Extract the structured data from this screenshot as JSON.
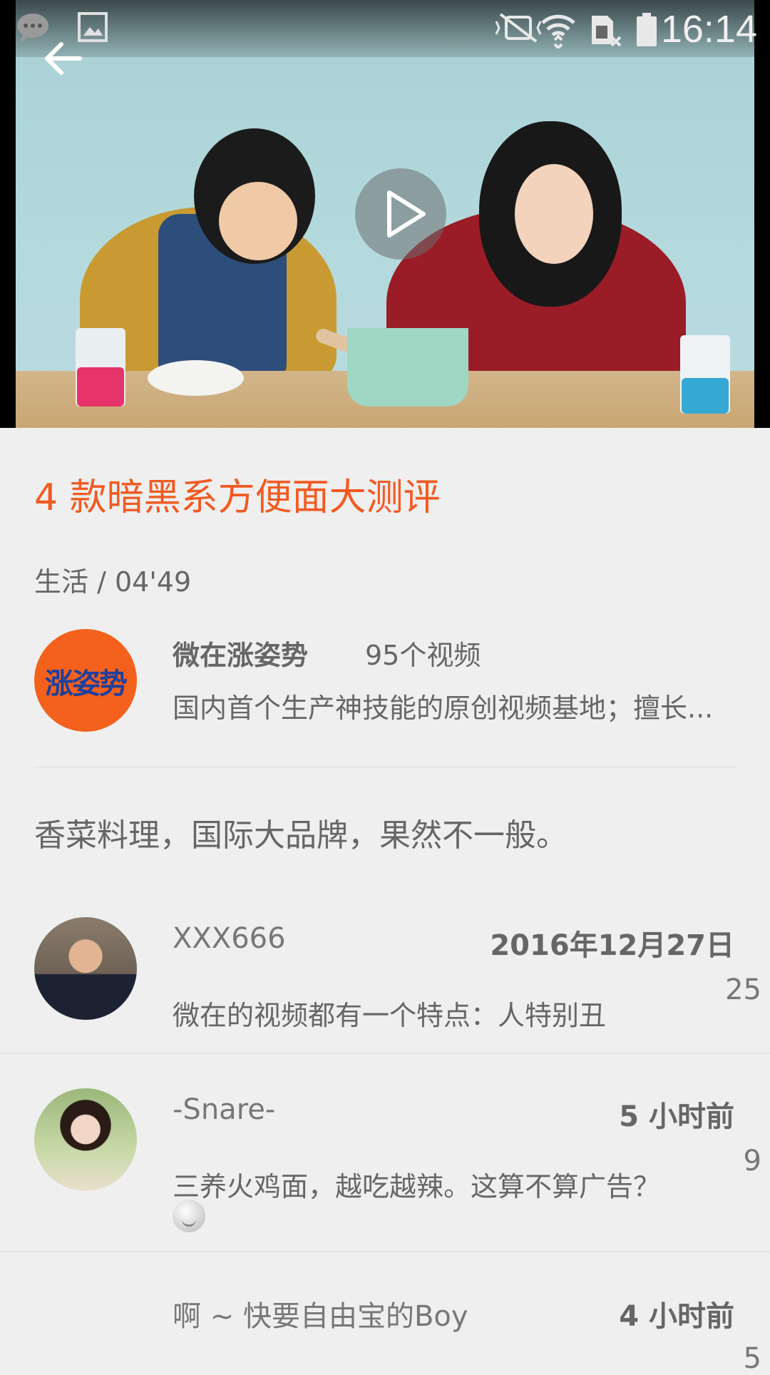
{
  "status_bar": {
    "time": "16:14",
    "icons": [
      "message-icon",
      "image-icon",
      "mute-icon",
      "wifi-icon",
      "no-sim-icon",
      "battery-icon"
    ]
  },
  "video": {
    "play_icon": "play-icon",
    "back_icon": "arrow-left-icon"
  },
  "title": "4 款暗黑系方便面大测评",
  "meta": "生活 / 04'49",
  "channel": {
    "logo_text": "涨姿势",
    "name": "微在涨姿势",
    "video_count": "95个视频",
    "description": "国内首个生产神技能的原创视频基地；擅长..."
  },
  "summary": "香菜料理，国际大品牌，果然不一般。",
  "comments": [
    {
      "user": "XXX666",
      "date": "2016年12月27日",
      "text": "微在的视频都有一个特点：人特别丑",
      "likes": "25"
    },
    {
      "user": "-Snare-",
      "date": "5 小时前",
      "text": "三养火鸡面，越吃越辣。这算不算广告？",
      "likes": "9",
      "has_emoji": true
    },
    {
      "user": "啊 ~ 快要自由宝的Boy",
      "date": "4 小时前",
      "text": "",
      "likes": "5"
    }
  ],
  "colors": {
    "accent": "#f25a22",
    "background": "#efefef"
  }
}
